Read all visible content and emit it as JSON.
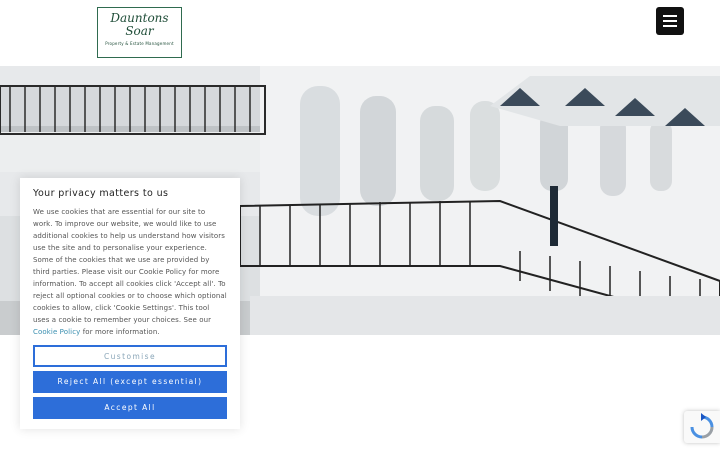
{
  "header": {
    "logo": {
      "line1": "Dauntons",
      "line2": "Soar",
      "tagline": "Property & Estate Management"
    },
    "menu_icon": "hamburger-icon"
  },
  "hero": {
    "image": "white-terraced-houses-with-iron-balconies"
  },
  "cookie_banner": {
    "title": "Your privacy matters to us",
    "body_text": "We use cookies that are essential for our site to work. To improve our website, we would like to use additional cookies to help us understand how visitors use the site and to personalise your experience. Some of the cookies that we use are provided by third parties. Please visit our Cookie Policy for more information. To accept all cookies click 'Accept all'. To reject all optional cookies or to choose which optional cookies to allow, click 'Cookie Settings'. This tool uses a cookie to remember your choices. See our ",
    "link_text": "Cookie Policy",
    "body_suffix": " for more information.",
    "customise_label": "Customise",
    "reject_label": "Reject All (except essential)",
    "accept_label": "Accept All"
  },
  "recaptcha": {
    "icon": "recaptcha-icon"
  },
  "colors": {
    "button_blue": "#2d6ed9",
    "logo_green": "#1f4d38",
    "link": "#3a8fb0"
  }
}
